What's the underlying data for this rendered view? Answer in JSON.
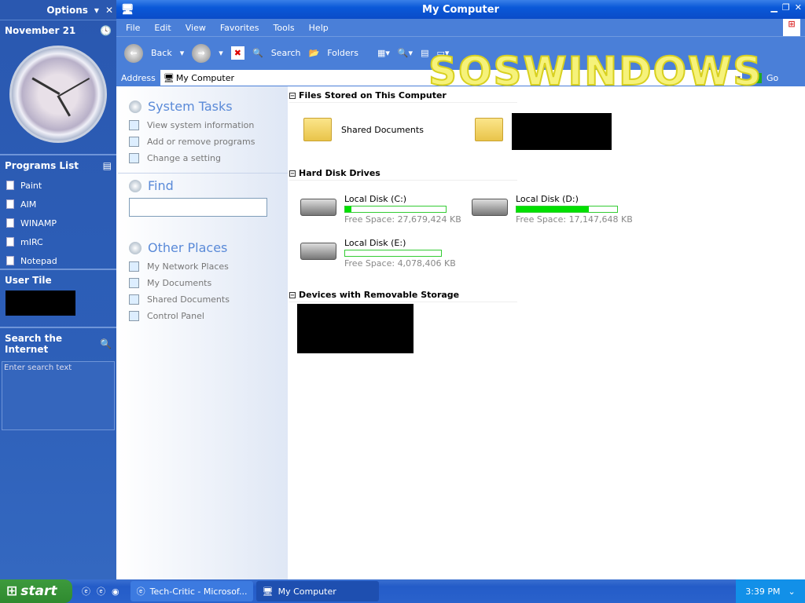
{
  "sidebar": {
    "options": "Options",
    "date": "November 21",
    "programs_title": "Programs List",
    "programs": [
      {
        "label": "Paint"
      },
      {
        "label": "AIM"
      },
      {
        "label": "WINAMP"
      },
      {
        "label": "mIRC"
      },
      {
        "label": "Notepad"
      }
    ],
    "user_tile": "User Tile",
    "search_title": "Search the Internet",
    "search_placeholder": "Enter search text"
  },
  "window": {
    "title": "My Computer",
    "menu": [
      "File",
      "Edit",
      "View",
      "Favorites",
      "Tools",
      "Help"
    ],
    "toolbar": {
      "back": "Back",
      "search": "Search",
      "folders": "Folders"
    },
    "address_label": "Address",
    "address_value": "My Computer",
    "go": "Go"
  },
  "watermark": "SOSWINDOWS",
  "tasks": {
    "system_title": "System Tasks",
    "system": [
      "View system information",
      "Add or remove programs",
      "Change a setting"
    ],
    "find_title": "Find",
    "other_title": "Other Places",
    "other": [
      "My Network Places",
      "My Documents",
      "Shared Documents",
      "Control Panel"
    ]
  },
  "groups": {
    "files": "Files Stored on This Computer",
    "hdd": "Hard Disk Drives",
    "removable": "Devices with Removable Storage"
  },
  "files": [
    {
      "label": "Shared Documents"
    }
  ],
  "disks": [
    {
      "label": "Local Disk (C:)",
      "free": "Free Space: 27,679,424 KB",
      "used_pct": 6
    },
    {
      "label": "Local Disk (D:)",
      "free": "Free Space: 17,147,648 KB",
      "used_pct": 72
    },
    {
      "label": "Local Disk (E:)",
      "free": "Free Space: 4,078,406 KB",
      "used_pct": 0
    }
  ],
  "taskbar": {
    "start": "start",
    "tasks": [
      "Tech-Critic - Microsof...",
      "My Computer"
    ],
    "time": "3:39 PM"
  }
}
